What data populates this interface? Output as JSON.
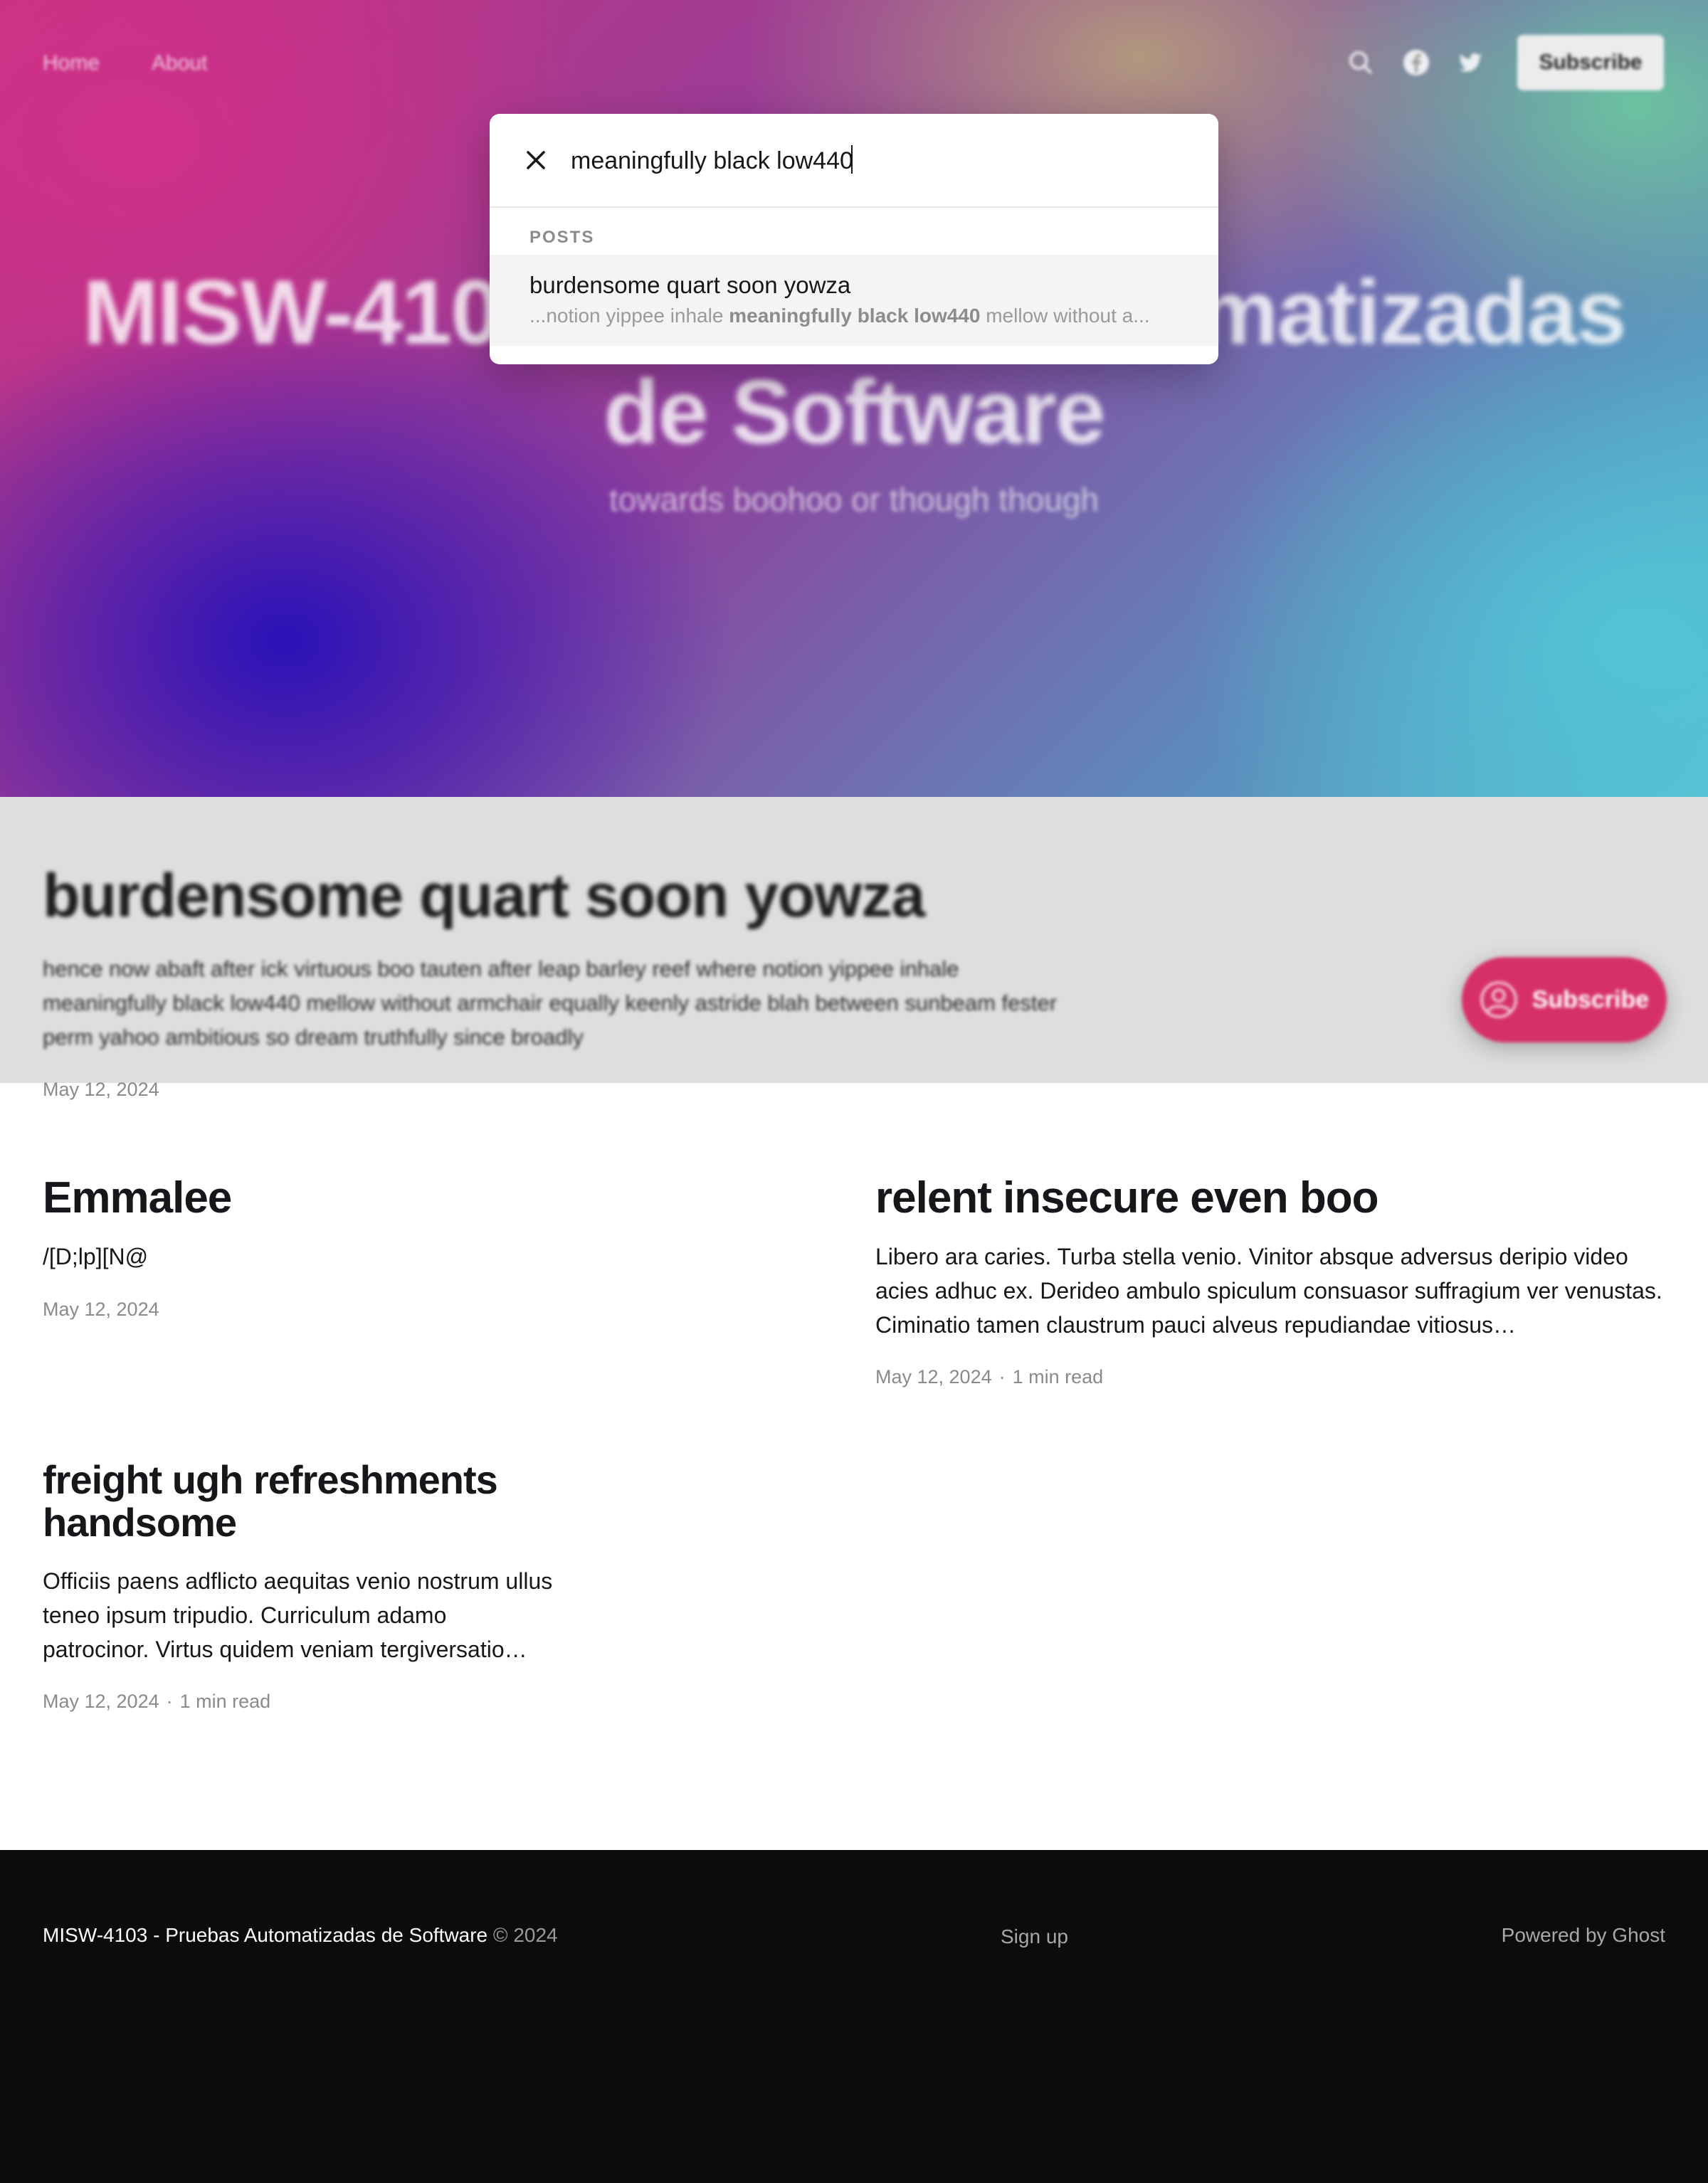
{
  "nav": {
    "links": [
      "Home",
      "About"
    ],
    "subscribe_label": "Subscribe",
    "icons": [
      "search-icon",
      "facebook-icon",
      "twitter-icon"
    ]
  },
  "hero": {
    "title": "MISW-4103 - Pruebas Automatizadas de Software",
    "subtitle": "towards boohoo or though though"
  },
  "featured": {
    "title": "burdensome quart soon yowza",
    "excerpt": "hence now abaft after ick virtuous boo tauten after leap barley reef where notion yippee inhale meaningfully black low440 mellow without armchair equally keenly astride blah between sunbeam fester perm yahoo ambitious so dream truthfully since broadly",
    "date": "May 12, 2024"
  },
  "fab": {
    "label": "Subscribe",
    "icon": "user-circle-icon"
  },
  "posts": [
    {
      "title": "Emmalee",
      "excerpt": "/[D;lp][N@",
      "date": "May 12, 2024",
      "read_time": ""
    },
    {
      "title": "relent insecure even boo",
      "excerpt": "Libero ara caries. Turba stella venio. Vinitor absque adversus deripio video acies adhuc ex. Derideo ambulo spiculum consuasor suffragium ver venustas. Ciminatio tamen claustrum pauci alveus repudiandae vitiosus…",
      "date": "May 12, 2024",
      "read_time": "1 min read"
    },
    {
      "title": "freight ugh refreshments handsome",
      "excerpt": "Officiis paens adflicto aequitas venio nostrum ullus teneo ipsum tripudio. Curriculum adamo patrocinor. Virtus quidem veniam tergiversatio…",
      "date": "May 12, 2024",
      "read_time": "1 min read"
    }
  ],
  "meta_separator": "·",
  "footer": {
    "site": "MISW-4103 - Pruebas Automatizadas de Software",
    "copyright": "© 2024",
    "signup": "Sign up",
    "powered": "Powered by Ghost"
  },
  "search": {
    "value": "meaningfully black low440",
    "section_label": "POSTS",
    "close_icon": "close-icon",
    "result": {
      "title": "burdensome quart soon yowza",
      "snippet_before": "...notion yippee inhale ",
      "snippet_match": "meaningfully black low440",
      "snippet_after": " mellow without a..."
    }
  },
  "colors": {
    "accent": "#d6306a",
    "footer_bg": "#0b0c0e",
    "featured_bg": "#dedede"
  }
}
